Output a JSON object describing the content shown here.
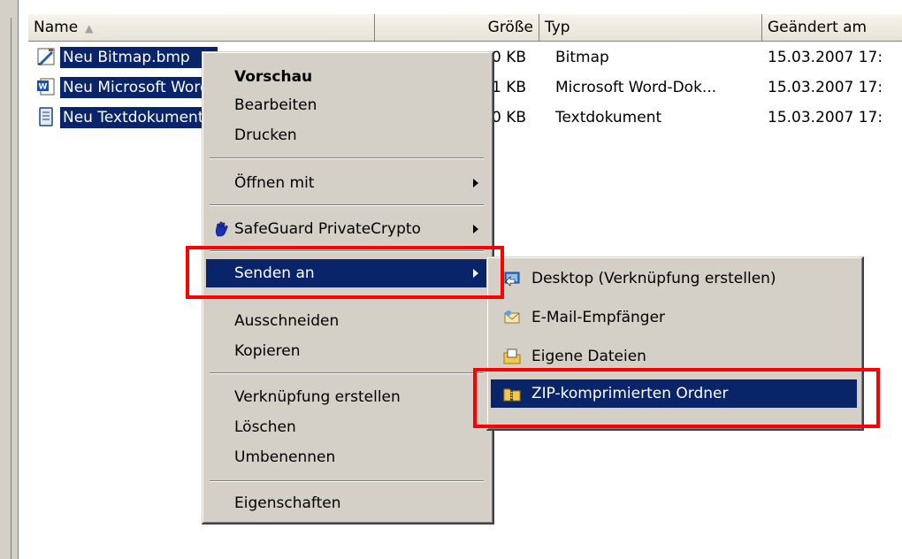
{
  "columns": {
    "name": "Name",
    "size": "Größe",
    "type": "Typ",
    "modified": "Geändert am"
  },
  "files": [
    {
      "name": "Neu Bitmap.bmp",
      "size": "0 KB",
      "type": "Bitmap",
      "modified": "15.03.2007 17:",
      "icon": "bitmap-icon"
    },
    {
      "name": "Neu Microsoft Word-Dokument.doc",
      "size": "1 KB",
      "type": "Microsoft Word-Dok...",
      "modified": "15.03.2007 17:",
      "icon": "word-doc-icon"
    },
    {
      "name": "Neu Textdokument.txt",
      "size": "0 KB",
      "type": "Textdokument",
      "modified": "15.03.2007 17:",
      "icon": "text-doc-icon"
    }
  ],
  "context_menu": {
    "preview": "Vorschau",
    "edit": "Bearbeiten",
    "print": "Drucken",
    "open_with": "Öffnen mit",
    "safeguard": "SafeGuard PrivateCrypto",
    "send_to": "Senden an",
    "cut": "Ausschneiden",
    "copy": "Kopieren",
    "create_shortcut": "Verknüpfung erstellen",
    "delete": "Löschen",
    "rename": "Umbenennen",
    "properties": "Eigenschaften"
  },
  "send_to_menu": {
    "desktop": "Desktop (Verknüpfung erstellen)",
    "mail": "E-Mail-Empfänger",
    "my_files": "Eigene Dateien",
    "zip": "ZIP-komprimierten Ordner"
  },
  "colors": {
    "selection": "#0a246a",
    "menu_bg": "#d4d0c8",
    "highlight_box": "#ff0000"
  }
}
